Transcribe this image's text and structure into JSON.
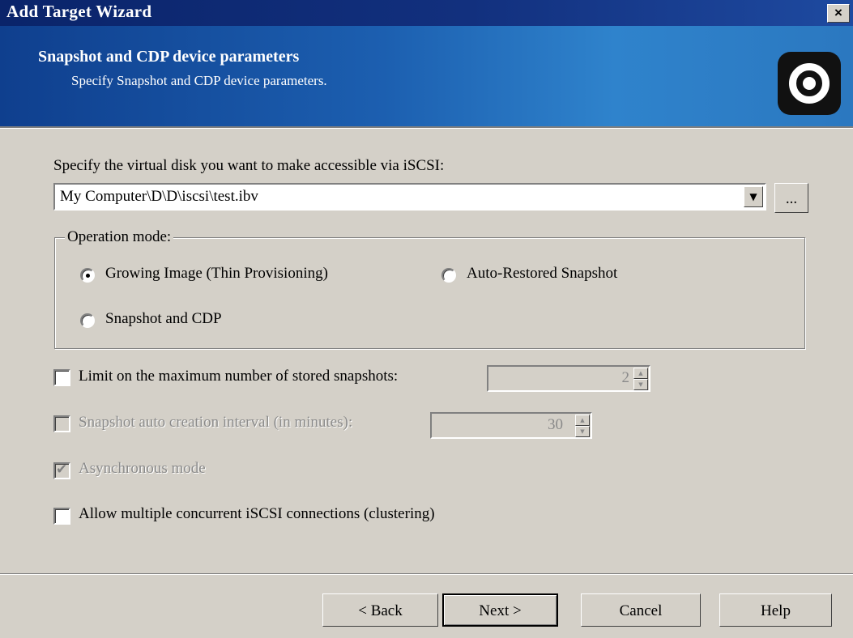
{
  "window": {
    "title": "Add Target Wizard",
    "close": "×"
  },
  "banner": {
    "heading": "Snapshot and CDP device parameters",
    "subtitle": "Specify Snapshot and CDP device parameters."
  },
  "disk": {
    "prompt": "Specify the virtual disk you want to make accessible via iSCSI:",
    "value": "My Computer\\D\\D\\iscsi\\test.ibv",
    "browse_label": "..."
  },
  "operation_mode": {
    "legend": "Operation mode:",
    "options": [
      {
        "label": "Growing Image (Thin Provisioning)",
        "selected": true
      },
      {
        "label": "Auto-Restored Snapshot",
        "selected": false
      },
      {
        "label": "Snapshot and CDP",
        "selected": false
      }
    ]
  },
  "options": {
    "limit_snapshots": {
      "label": "Limit on the maximum number of stored snapshots:",
      "checked": false,
      "value": "2"
    },
    "auto_interval": {
      "label": "Snapshot auto creation interval (in minutes):",
      "checked": false,
      "value": "30",
      "enabled": false
    },
    "async_mode": {
      "label": "Asynchronous mode",
      "checked": true,
      "enabled": false
    },
    "multiple_connections": {
      "label": "Allow multiple concurrent iSCSI connections (clustering)",
      "checked": false
    }
  },
  "buttons": {
    "back": "< Back",
    "next": "Next >",
    "cancel": "Cancel",
    "help": "Help"
  }
}
